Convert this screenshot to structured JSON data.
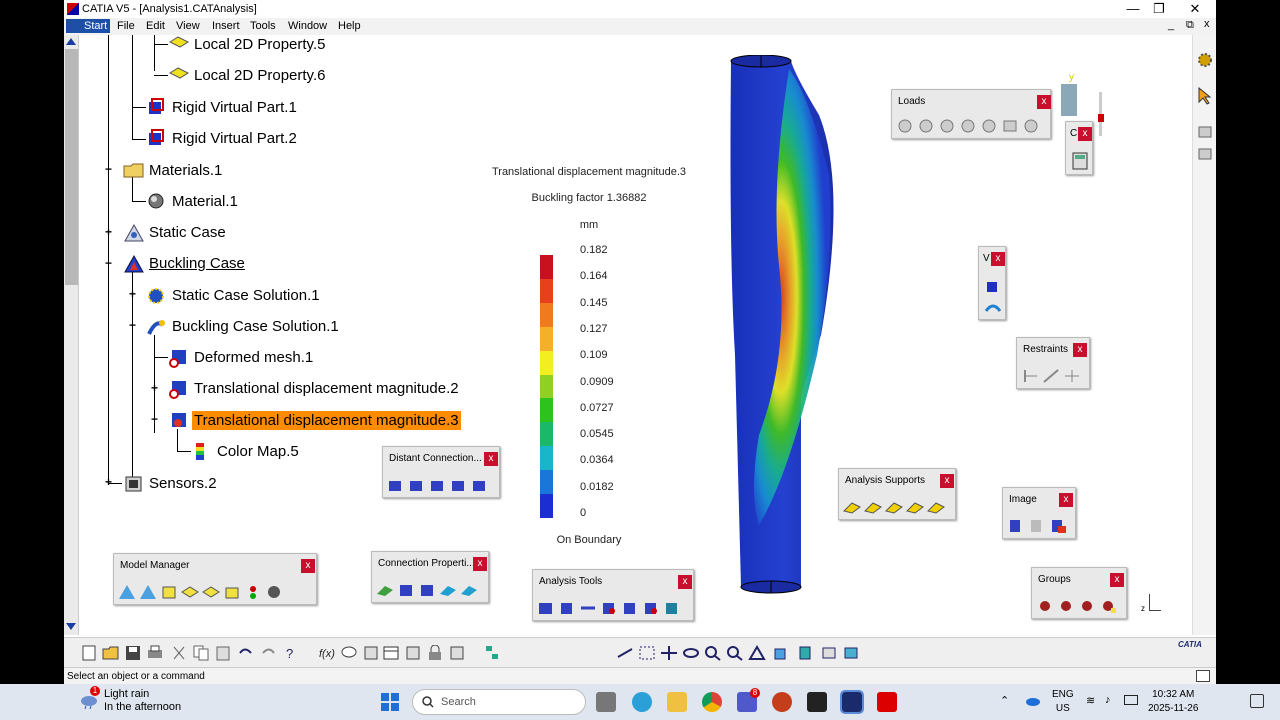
{
  "window": {
    "title": "CATIA V5 - [Analysis1.CATAnalysis]",
    "minimize": "—",
    "restore": "❐",
    "close": "✕",
    "inner_minimize": "_",
    "inner_restore": "⧉",
    "inner_close": "x"
  },
  "menu": [
    "Start",
    "File",
    "Edit",
    "View",
    "Insert",
    "Tools",
    "Window",
    "Help"
  ],
  "tree": {
    "n0": "Local 2D Property.5",
    "n1": "Local 2D Property.6",
    "n2": "Rigid Virtual Part.1",
    "n3": "Rigid Virtual Part.2",
    "n4": "Materials.1",
    "n5": "Material.1",
    "n6": "Static Case",
    "n7": "Buckling Case",
    "n8": "Static Case Solution.1",
    "n9": "Buckling Case Solution.1",
    "n10": "Deformed mesh.1",
    "n11": "Translational displacement magnitude.2",
    "n12": "Translational displacement magnitude.3",
    "n13": "Color Map.5",
    "n14": "Sensors.2"
  },
  "legend": {
    "title": "Translational displacement magnitude.3",
    "subtitle": "Buckling factor 1.36882",
    "unit": "mm",
    "ticks": [
      "0.182",
      "0.164",
      "0.145",
      "0.127",
      "0.109",
      "0.0909",
      "0.0727",
      "0.0545",
      "0.0364",
      "0.0182",
      "0"
    ],
    "footer": "On Boundary",
    "colors": [
      "#c8101e",
      "#e8401a",
      "#f07a1e",
      "#f5b02a",
      "#f2ee22",
      "#8fd022",
      "#2ec21e",
      "#1cb86a",
      "#18b6c8",
      "#1a76d8",
      "#1a2ed2"
    ]
  },
  "toolbars": {
    "loads": "Loads",
    "v": "V",
    "restraints": "Restraints",
    "distant": "Distant Connection...",
    "analysis_supports": "Analysis Supports",
    "image": "Image",
    "model_manager": "Model Manager",
    "connection": "Connection Properti...",
    "analysis_tools": "Analysis Tools",
    "groups": "Groups",
    "close_label": "x",
    "c": "C"
  },
  "axis": {
    "y": "y",
    "z": "z"
  },
  "status": "Select an object or a command",
  "catia_logo": "CATIA",
  "taskbar": {
    "weather_line1": "Light rain",
    "weather_line2": "In the afternoon",
    "weather_badge": "1",
    "search": "Search",
    "lang1": "ENG",
    "lang2": "US",
    "time": "10:32 AM",
    "date": "2025-11-26",
    "teams_badge": "8"
  }
}
